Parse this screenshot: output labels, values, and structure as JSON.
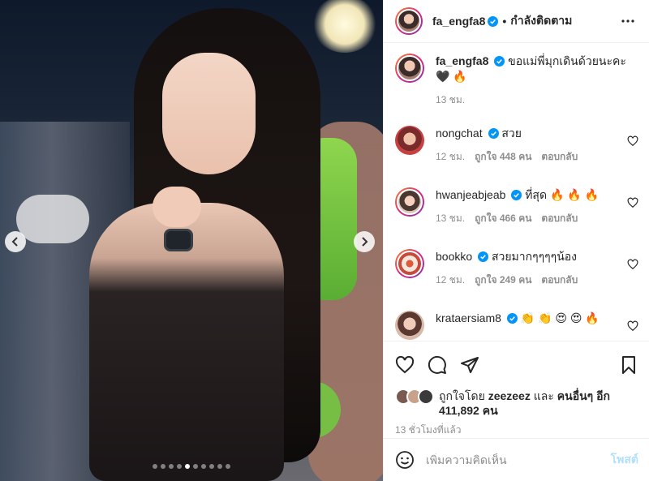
{
  "post": {
    "author": "fa_engfa8",
    "follow_status": "กำลังติดตาม",
    "separator": "•",
    "slide_count": 10,
    "active_slide": 5
  },
  "caption": {
    "username": "fa_engfa8",
    "text": "ขอแม่พี่มุกเดินด้วยนะคะ",
    "emojis": "🖤 🔥",
    "time": "13 ชม."
  },
  "comments": [
    {
      "username": "nongchat",
      "verified": true,
      "text": "สวย",
      "time": "12 ชม.",
      "likes": "ถูกใจ 448 คน",
      "reply": "ตอบกลับ"
    },
    {
      "username": "hwanjeabjeab",
      "verified": true,
      "text": "ที่สุด 🔥 🔥 🔥",
      "time": "13 ชม.",
      "likes": "ถูกใจ 466 คน",
      "reply": "ตอบกลับ"
    },
    {
      "username": "bookko",
      "verified": true,
      "text": "สวยมากๆๆๆๆน้อง",
      "time": "12 ชม.",
      "likes": "ถูกใจ 249 คน",
      "reply": "ตอบกลับ"
    },
    {
      "username": "krataersiam8",
      "verified": true,
      "text": "👏 👏 😍 😍 🔥",
      "time": "",
      "likes": "",
      "reply": ""
    }
  ],
  "likes": {
    "prefix": "ถูกใจโดย",
    "user": "zeezeez",
    "middle": "และ",
    "others": "คนอื่นๆ อีก",
    "count": "411,892 คน"
  },
  "timestamp": "13 ชั่วโมงที่แล้ว",
  "add_comment": {
    "placeholder": "เพิ่มความคิดเห็น",
    "post_label": "โพสต์"
  },
  "colors": {
    "verified_blue": "#0095f6",
    "post_disabled": "#b2dffc",
    "meta_gray": "#8e8e8e"
  }
}
